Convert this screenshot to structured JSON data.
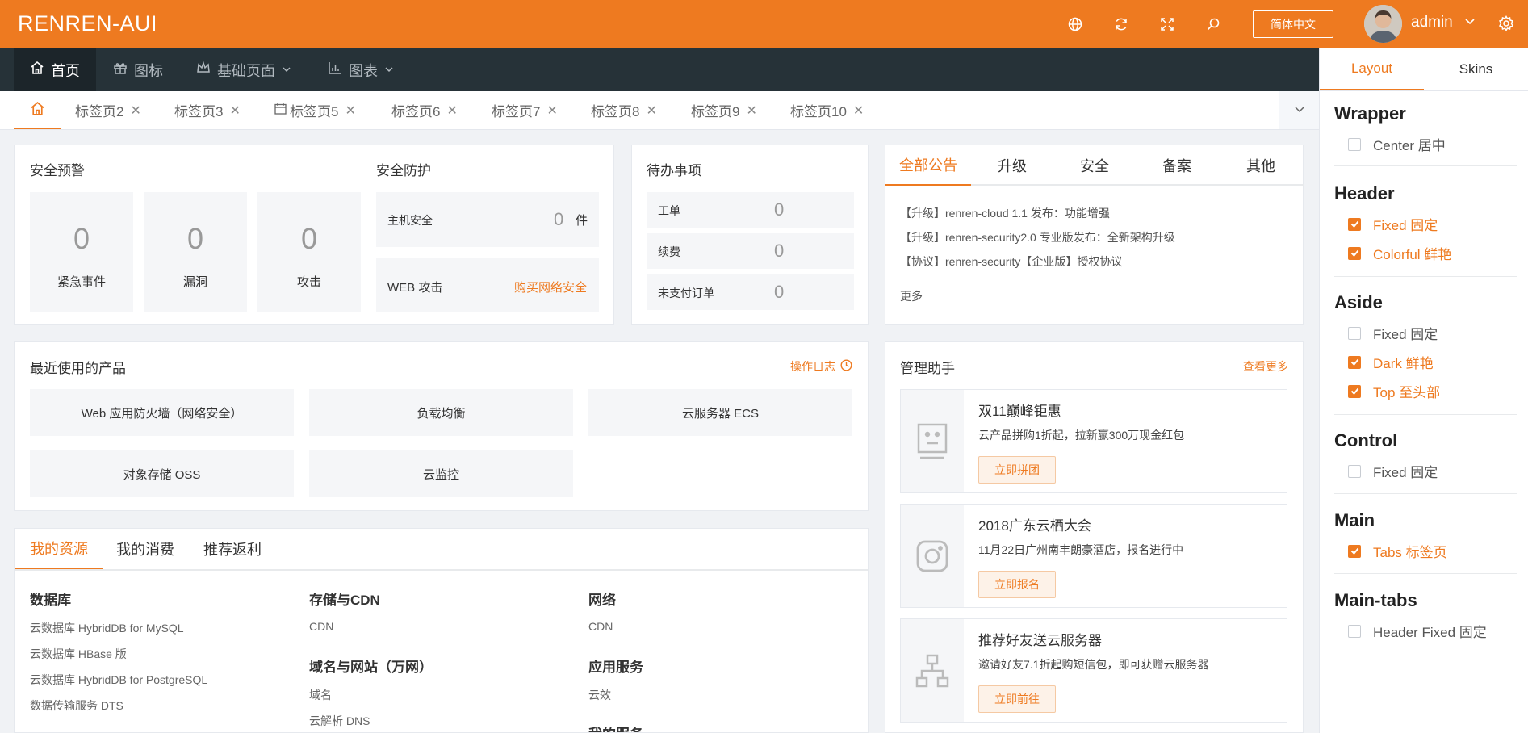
{
  "header": {
    "brand": "RENREN-AUI",
    "lang_button": "简体中文",
    "username": "admin",
    "icons": [
      "globe-icon",
      "refresh-icon",
      "fullscreen-icon",
      "search-icon",
      "settings-icon"
    ]
  },
  "nav": {
    "items": [
      {
        "label": "首页",
        "icon": "home-icon",
        "active": true
      },
      {
        "label": "图标",
        "icon": "gift-icon"
      },
      {
        "label": "基础页面",
        "icon": "crown-icon",
        "dropdown": true
      },
      {
        "label": "图表",
        "icon": "bar-chart-icon",
        "dropdown": true
      }
    ]
  },
  "tabs": {
    "items": [
      "标签页2",
      "标签页3",
      "标签页5",
      "标签页6",
      "标签页7",
      "标签页8",
      "标签页9",
      "标签页10"
    ]
  },
  "security": {
    "alert_title": "安全预警",
    "alerts": [
      {
        "value": "0",
        "label": "紧急事件"
      },
      {
        "value": "0",
        "label": "漏洞"
      },
      {
        "value": "0",
        "label": "攻击"
      }
    ],
    "protect_title": "安全防护",
    "host_label": "主机安全",
    "host_value": "0",
    "host_unit": "件",
    "web_label": "WEB 攻击",
    "web_link": "购买网络安全"
  },
  "todo": {
    "title": "待办事项",
    "items": [
      {
        "label": "工单",
        "value": "0"
      },
      {
        "label": "续费",
        "value": "0"
      },
      {
        "label": "未支付订单",
        "value": "0"
      }
    ]
  },
  "notices": {
    "tabs": [
      "全部公告",
      "升级",
      "安全",
      "备案",
      "其他"
    ],
    "items": [
      "【升级】renren-cloud 1.1 发布：功能增强",
      "【升级】renren-security2.0 专业版发布：全新架构升级",
      "【协议】renren-security【企业版】授权协议"
    ],
    "more": "更多"
  },
  "products": {
    "title": "最近使用的产品",
    "log_link": "操作日志",
    "items": [
      "Web 应用防火墙（网络安全）",
      "负载均衡",
      "云服务器 ECS",
      "对象存储 OSS",
      "云监控"
    ]
  },
  "resources": {
    "tabs": [
      "我的资源",
      "我的消费",
      "推荐返利"
    ],
    "col1_head": "数据库",
    "col1_links": [
      "云数据库 HybridDB for MySQL",
      "云数据库 HBase 版",
      "云数据库 HybridDB for PostgreSQL",
      "数据传输服务 DTS"
    ],
    "col2_head1": "存储与CDN",
    "col2_links1": [
      "CDN"
    ],
    "col2_head2": "域名与网站（万网）",
    "col2_links2": [
      "域名",
      "云解析 DNS"
    ],
    "col3_head1": "网络",
    "col3_links1": [
      "CDN"
    ],
    "col3_head2": "应用服务",
    "col3_links2": [
      "云效"
    ],
    "col3_head3": "我的服务"
  },
  "helper": {
    "title": "管理助手",
    "more": "查看更多",
    "promos": [
      {
        "title": "双11巅峰钜惠",
        "desc": "云产品拼购1折起，拉新赢300万现金红包",
        "button": "立即拼团",
        "icon": "robot-face-icon"
      },
      {
        "title": "2018广东云栖大会",
        "desc": "11月22日广州南丰朗豪酒店，报名进行中",
        "button": "立即报名",
        "icon": "instagram-icon"
      },
      {
        "title": "推荐好友送云服务器",
        "desc": "邀请好友7.1折起购短信包，即可获赠云服务器",
        "button": "立即前往",
        "icon": "org-chart-icon"
      }
    ]
  },
  "panel": {
    "tabs": [
      "Layout",
      "Skins"
    ],
    "sections": [
      {
        "head": "Wrapper",
        "options": [
          {
            "label": "Center 居中",
            "checked": false
          }
        ]
      },
      {
        "head": "Header",
        "options": [
          {
            "label": "Fixed 固定",
            "checked": true
          },
          {
            "label": "Colorful 鲜艳",
            "checked": true
          }
        ]
      },
      {
        "head": "Aside",
        "options": [
          {
            "label": "Fixed 固定",
            "checked": false
          },
          {
            "label": "Dark 鲜艳",
            "checked": true
          },
          {
            "label": "Top 至头部",
            "checked": true
          }
        ]
      },
      {
        "head": "Control",
        "options": [
          {
            "label": "Fixed 固定",
            "checked": false
          }
        ]
      },
      {
        "head": "Main",
        "options": [
          {
            "label": "Tabs 标签页",
            "checked": true
          }
        ]
      },
      {
        "head": "Main-tabs",
        "options": [
          {
            "label": "Header Fixed 固定",
            "checked": false
          }
        ]
      }
    ]
  },
  "colors": {
    "accent": "#ee7a20",
    "nav_bg": "#263238"
  }
}
